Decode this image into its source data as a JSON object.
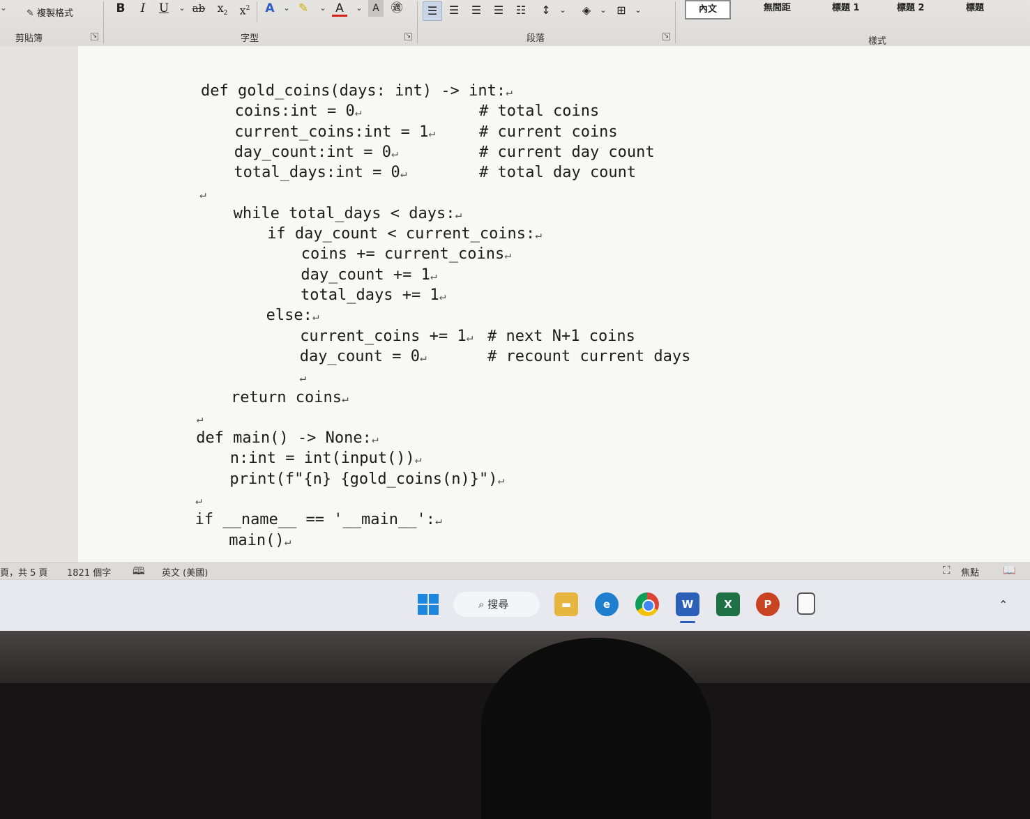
{
  "ribbon": {
    "clipboard": {
      "format_painter": "複製格式",
      "group_label": "剪貼簿"
    },
    "font": {
      "group_label": "字型"
    },
    "paragraph": {
      "group_label": "段落"
    },
    "styles": {
      "group_label": "樣式",
      "items": [
        "內文",
        "無間距",
        "標題 1",
        "標題 2",
        "標題"
      ]
    }
  },
  "document": {
    "lines": [
      {
        "indent": 0,
        "text": "def gold_coins(days: int) -> int:"
      },
      {
        "indent": 1,
        "text": "coins:int = 0",
        "comment": "# total coins"
      },
      {
        "indent": 1,
        "text": "current_coins:int = 1",
        "comment": "# current coins"
      },
      {
        "indent": 1,
        "text": "day_count:int = 0",
        "comment": "# current day count"
      },
      {
        "indent": 1,
        "text": "total_days:int = 0",
        "comment": "# total day count"
      },
      {
        "indent": 0,
        "text": ""
      },
      {
        "indent": 1,
        "text": "while total_days < days:"
      },
      {
        "indent": 2,
        "text": "if day_count < current_coins:"
      },
      {
        "indent": 3,
        "text": "coins += current_coins"
      },
      {
        "indent": 3,
        "text": "day_count += 1"
      },
      {
        "indent": 3,
        "text": "total_days += 1"
      },
      {
        "indent": 2,
        "text": "else:"
      },
      {
        "indent": 3,
        "text": "current_coins += 1",
        "comment": "# next N+1 coins"
      },
      {
        "indent": 3,
        "text": "day_count = 0",
        "comment": "# recount current days"
      },
      {
        "indent": 3,
        "text": ""
      },
      {
        "indent": 1,
        "text": "return coins"
      },
      {
        "indent": 0,
        "text": ""
      },
      {
        "indent": 0,
        "text": "def main() -> None:"
      },
      {
        "indent": 1,
        "text": "n:int = int(input())"
      },
      {
        "indent": 1,
        "text": "print(f\"{n} {gold_coins(n)}\")"
      },
      {
        "indent": 0,
        "text": ""
      },
      {
        "indent": 0,
        "text": "if __name__ == '__main__':"
      },
      {
        "indent": 1,
        "text": "main()"
      }
    ]
  },
  "status": {
    "page_info": "頁，共 5 頁",
    "word_count": "1821 個字",
    "language": "英文 (美國)",
    "focus": "焦點"
  },
  "taskbar": {
    "search": "搜尋",
    "apps": [
      "windows-start",
      "file-explorer",
      "edge",
      "chrome",
      "word",
      "excel",
      "powerpoint",
      "notepad"
    ]
  }
}
